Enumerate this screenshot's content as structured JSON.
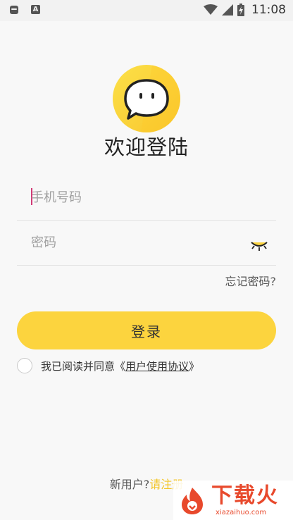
{
  "status_bar": {
    "time": "11:08",
    "left_icons": [
      "app-notification-icon",
      "a-text-icon"
    ],
    "right_icons": [
      "wifi-icon",
      "signal-icon",
      "battery-charging-icon"
    ]
  },
  "logo": {
    "icon": "chat-bubble-face-icon",
    "color": "#fcd43e"
  },
  "title": "欢迎登陆",
  "form": {
    "phone_placeholder": "手机号码",
    "password_placeholder": "密码",
    "password_toggle_icon": "closed-eye-icon"
  },
  "forgot_password": "忘记密码?",
  "login_button": "登录",
  "agreement": {
    "prefix": "我已阅读并同意《",
    "link": "用户使用协议",
    "suffix": "》"
  },
  "register": {
    "prefix": "新用户?",
    "link": "请注册"
  },
  "watermark": {
    "title": "下载火",
    "url": "xiazaihuo.com"
  },
  "colors": {
    "accent": "#fcd43e",
    "link": "#f3c526",
    "watermark": "#e8492c",
    "caret": "#d13a75"
  }
}
